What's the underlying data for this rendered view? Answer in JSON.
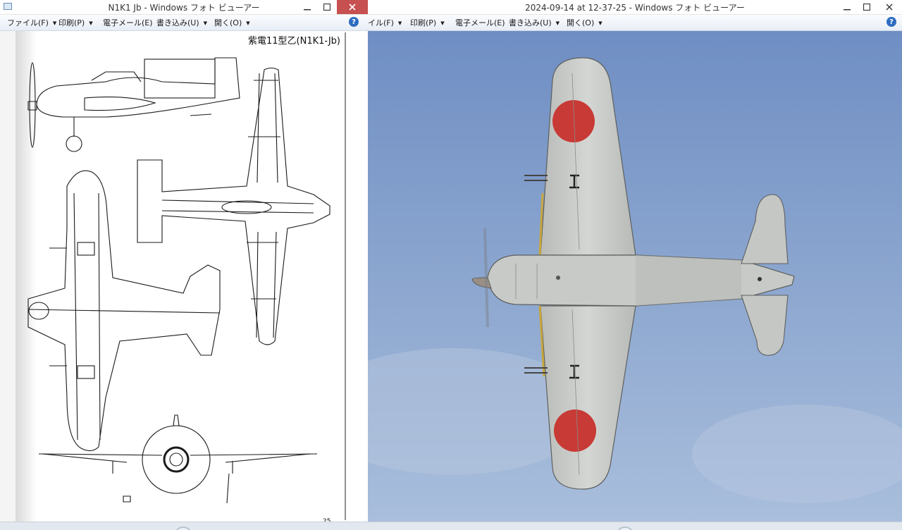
{
  "left_window": {
    "title": "N1K1 Jb - Windows フォト ビューアー",
    "menu": [
      {
        "label": "ファイル(F)",
        "has_dropdown": true
      },
      {
        "label": "印刷(P)",
        "has_dropdown": true
      },
      {
        "label": "電子メール(E)",
        "has_dropdown": false
      },
      {
        "label": "書き込み(U)",
        "has_dropdown": true
      },
      {
        "label": "開く(O)",
        "has_dropdown": true
      }
    ],
    "help": "?",
    "image": {
      "drawing_title": "紫電11型乙(N1K1-Jb)",
      "page_number": "25"
    }
  },
  "right_window": {
    "title": "2024-09-14 at 12-37-25 - Windows フォト ビューアー",
    "menu": [
      {
        "label": "イル(F)",
        "has_dropdown": true
      },
      {
        "label": "印刷(P)",
        "has_dropdown": true
      },
      {
        "label": "電子メール(E)",
        "has_dropdown": false
      },
      {
        "label": "書き込み(U)",
        "has_dropdown": true
      },
      {
        "label": "開く(O)",
        "has_dropdown": true
      }
    ],
    "help": "?",
    "image": {
      "sky_color": "#7f9bc8",
      "hull_color": "#c9ccc9",
      "roundel_color": "#c83a35"
    }
  },
  "icons": [
    "app-icon",
    "minimize-icon",
    "maximize-icon",
    "close-icon",
    "help-icon",
    "chevron-down-icon"
  ]
}
